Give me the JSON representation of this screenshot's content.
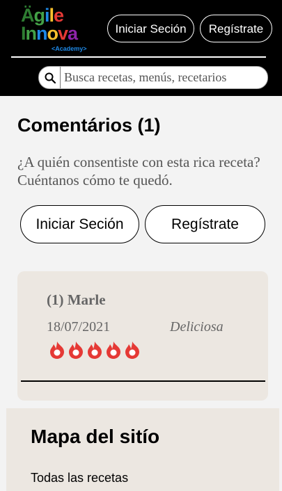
{
  "header": {
    "logo": {
      "line1": "Ägile",
      "line2": "Innova",
      "sub": "<Academy>"
    },
    "login_label": "Iniciar Seción",
    "register_label": "Regístrate",
    "search": {
      "placeholder": "Busca recetas, menús, recetarios",
      "value": ""
    }
  },
  "comments": {
    "title": "Comentários (1)",
    "prompt": "¿A quién consentiste con esta rica receta? Cuéntanos cómo te quedó.",
    "login_label": "Iniciar Seción",
    "register_label": "Regístrate",
    "items": [
      {
        "name": "(1) Marle",
        "date": "18/07/2021",
        "text": "Deliciosa",
        "rating": 5,
        "max_rating": 5
      }
    ]
  },
  "sitemap": {
    "title": "Mapa del sitío",
    "links": [
      "Todas las recetas"
    ]
  },
  "colors": {
    "header_bg": "#000000",
    "card_bg": "#ece7e1",
    "rating": "#e53935",
    "page_bg": "#f3f3f3"
  },
  "icons": {
    "search": "search-icon",
    "rating": "flame-icon"
  }
}
